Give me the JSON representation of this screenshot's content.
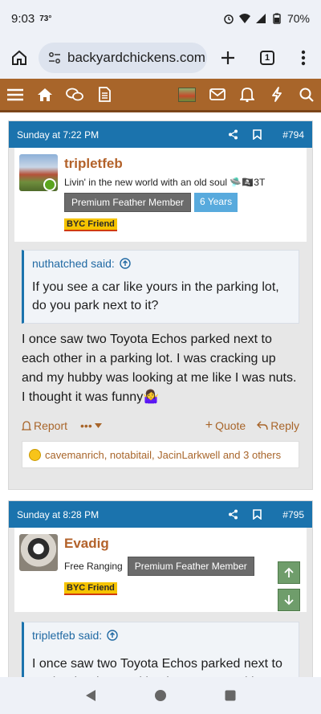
{
  "status": {
    "time": "9:03",
    "temp": "73°",
    "battery": "70%"
  },
  "browser": {
    "url": "backyardchickens.com",
    "tab_count": "1"
  },
  "posts": [
    {
      "date": "Sunday at 7:22 PM",
      "number": "#794",
      "username": "tripletfeb",
      "user_title": "Livin' in the new world with an old soul 🛸🏴‍☠️3T",
      "badge_member": "Premium Feather Member",
      "badge_years": "6 Years",
      "friend": "BYC Friend",
      "quote_author": "nuthatched said:",
      "quote_text": "If you see a car like yours in the parking lot, do you park next to it?",
      "message": "I once saw two Toyota Echos parked next to each other in a parking lot. I was cracking up and my hubby was looking at me like I was nuts. I thought it was funny🤷‍♀️",
      "report_label": "Report",
      "more_label": "•••",
      "quote_label": "Quote",
      "reply_label": "Reply",
      "reactions": "cavemanrich, notabitail, JacinLarkwell and 3 others"
    },
    {
      "date": "Sunday at 8:28 PM",
      "number": "#795",
      "username": "Evadig",
      "user_title": "Free Ranging",
      "badge_member": "Premium Feather Member",
      "friend": "BYC Friend",
      "quote_author": "tripletfeb said:",
      "quote_text": "I once saw two Toyota Echos parked next to each other in a parking lot. I was cracking"
    }
  ],
  "colors": {
    "brand_brown": "#a8652a",
    "header_blue": "#1b73ad",
    "vote_green": "#6f9d6b"
  }
}
